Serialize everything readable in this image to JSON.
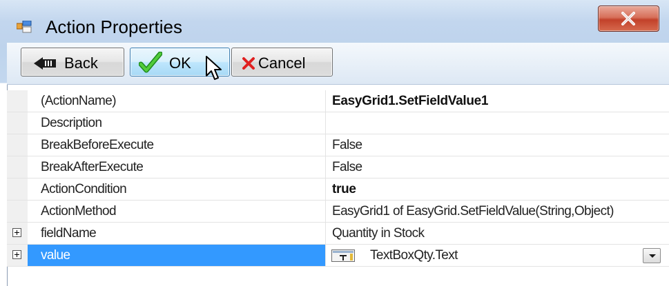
{
  "window": {
    "title": "Action Properties",
    "close_symbol": "x"
  },
  "toolbar": {
    "back_label": "Back",
    "ok_label": "OK",
    "cancel_label": "Cancel"
  },
  "properties": [
    {
      "name": "(ActionName)",
      "value": "EasyGrid1.SetFieldValue1",
      "bold": true
    },
    {
      "name": "Description",
      "value": ""
    },
    {
      "name": "BreakBeforeExecute",
      "value": "False"
    },
    {
      "name": "BreakAfterExecute",
      "value": "False"
    },
    {
      "name": "ActionCondition",
      "value": "true",
      "bold": true
    },
    {
      "name": "ActionMethod",
      "value": "EasyGrid1 of EasyGrid.SetFieldValue(String,Object)"
    },
    {
      "name": "fieldName",
      "value": "Quantity in Stock",
      "expandable": true
    },
    {
      "name": "value",
      "value": "TextBoxQty.Text",
      "expandable": true,
      "selected": true
    }
  ],
  "colors": {
    "selection": "#3399ff",
    "ok_check": "#2aa52a",
    "cancel_x": "#e02020"
  }
}
